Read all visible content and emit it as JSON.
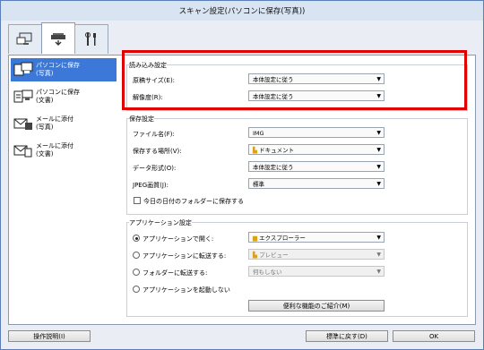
{
  "window": {
    "title": "スキャン設定(パソコンに保存(写真))"
  },
  "tabs": [
    {
      "icon": "scan-computer-icon"
    },
    {
      "icon": "scanner-icon"
    },
    {
      "icon": "tools-icon"
    }
  ],
  "sidebar": {
    "items": [
      {
        "label_1": "パソコンに保存",
        "label_2": "(写真)",
        "icon": "save-photo-icon",
        "selected": true
      },
      {
        "label_1": "パソコンに保存",
        "label_2": "(文書)",
        "icon": "save-document-icon",
        "selected": false
      },
      {
        "label_1": "メールに添付",
        "label_2": "(写真)",
        "icon": "email-photo-icon",
        "selected": false
      },
      {
        "label_1": "メールに添付",
        "label_2": "(文書)",
        "icon": "email-document-icon",
        "selected": false
      }
    ]
  },
  "scan_settings": {
    "title": "読み込み設定",
    "paper_size_label": "原稿サイズ(E):",
    "paper_size_value": "本体設定に従う",
    "resolution_label": "解像度(R):",
    "resolution_value": "本体設定に従う"
  },
  "save_settings": {
    "title": "保存設定",
    "filename_label": "ファイル名(F):",
    "filename_value": "IMG",
    "save_in_label": "保存する場所(V):",
    "save_in_value": "ドキュメント",
    "format_label": "データ形式(O):",
    "format_value": "本体設定に従う",
    "jpeg_label": "JPEG画質(J):",
    "jpeg_value": "標準",
    "subfolder_label": "今日の日付のフォルダーに保存する"
  },
  "app_settings": {
    "title": "アプリケーション設定",
    "open_app_label": "アプリケーションで開く:",
    "open_app_value": "エクスプローラー",
    "send_app_label": "アプリケーションに転送する:",
    "send_app_value": "プレビュー",
    "send_folder_label": "フォルダーに転送する:",
    "send_folder_value": "何もしない",
    "no_app_label": "アプリケーションを起動しない",
    "more_button": "便利な機能のご紹介(M)"
  },
  "footer": {
    "instructions": "操作説明(I)",
    "defaults": "標準に戻す(D)",
    "ok": "OK"
  }
}
